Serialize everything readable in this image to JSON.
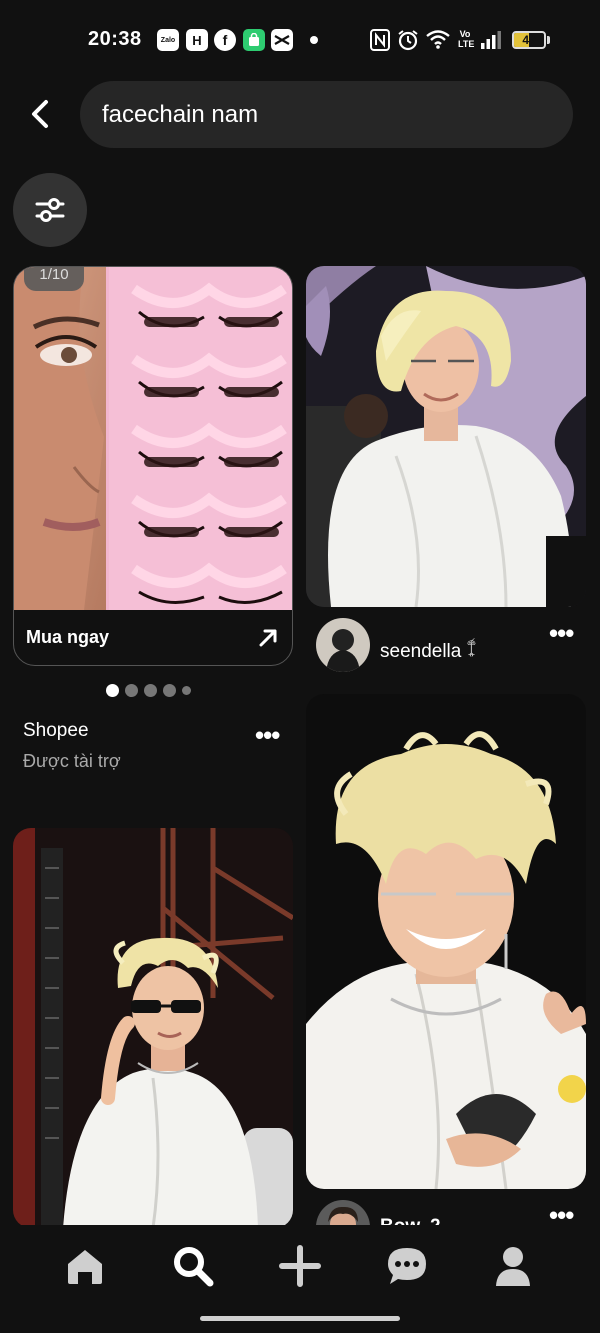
{
  "status_bar": {
    "time": "20:38",
    "apps": [
      "Zalo",
      "H",
      "f",
      "bag",
      "capcut"
    ],
    "volte": "Vo LTE",
    "battery": "49",
    "battery_level": 0.49
  },
  "search": {
    "query": "facechain nam",
    "back_icon": "back-arrow-icon",
    "filter_icon": "filter-sliders-icon"
  },
  "ad_pin": {
    "page_counter": "1/10",
    "cta_label": "Mua ngay",
    "advertiser": "Shopee",
    "sponsored_label": "Được tài trợ",
    "carousel_dots": 5,
    "active_dot": 0
  },
  "pins": [
    {
      "creator": "seendella 𓍎",
      "image": "blonde-man-white-shirt-glasses"
    },
    {
      "creator": "Bow. 2",
      "image": "blonde-man-laughing-glasses"
    },
    {
      "creator": "",
      "image": "blonde-man-sunglasses-stage"
    }
  ],
  "bottom_nav": {
    "items": [
      "home",
      "search",
      "create",
      "messages",
      "profile"
    ],
    "active": "search"
  },
  "colors": {
    "background": "#111111",
    "search_field": "#262626",
    "filter_button": "#333333",
    "battery": "#e2c23a"
  }
}
